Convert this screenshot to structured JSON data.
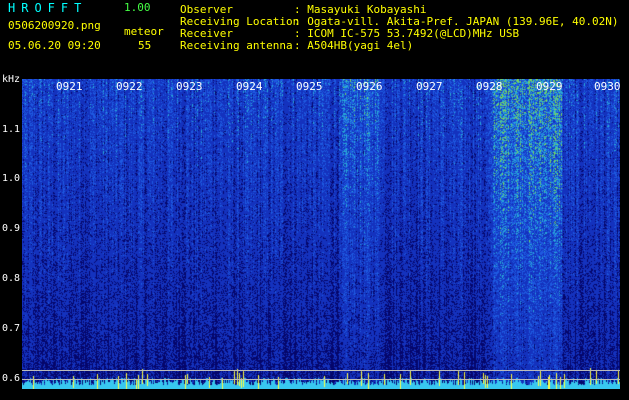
{
  "header": {
    "app_title": "HROFFT",
    "app_version": "1.00",
    "file_name": "0506200920.png",
    "mode_label": "meteor",
    "date_time": "05.06.20 09:20",
    "count": "55"
  },
  "info": [
    {
      "key": "Observer",
      "value": ": Masayuki Kobayashi"
    },
    {
      "key": "Receiving Location",
      "value": ": Ogata-vill. Akita-Pref. JAPAN (139.96E, 40.02N)"
    },
    {
      "key": "Receiver",
      "value": ": ICOM IC-575 53.7492(@LCD)MHz USB"
    },
    {
      "key": "Receiving antenna",
      "value": ": A504HB(yagi 4el)"
    }
  ],
  "axis": {
    "unit": "kHz",
    "y_labels": [
      "1.1",
      "1.0",
      "0.9",
      "0.8",
      "0.7",
      "0.6"
    ],
    "x_labels": [
      "0921",
      "0922",
      "0923",
      "0924",
      "0925",
      "0926",
      "0927",
      "0928",
      "0929",
      "0930"
    ]
  },
  "colors": {
    "text_yellow": "#ffff00",
    "text_cyan": "#00ffff",
    "text_green": "#44ff44",
    "spectrogram_bg": "#05066b",
    "noise_blue": "#1e4bd8",
    "noise_cyan": "#28b0d8",
    "noise_green": "#7ad85a"
  }
}
